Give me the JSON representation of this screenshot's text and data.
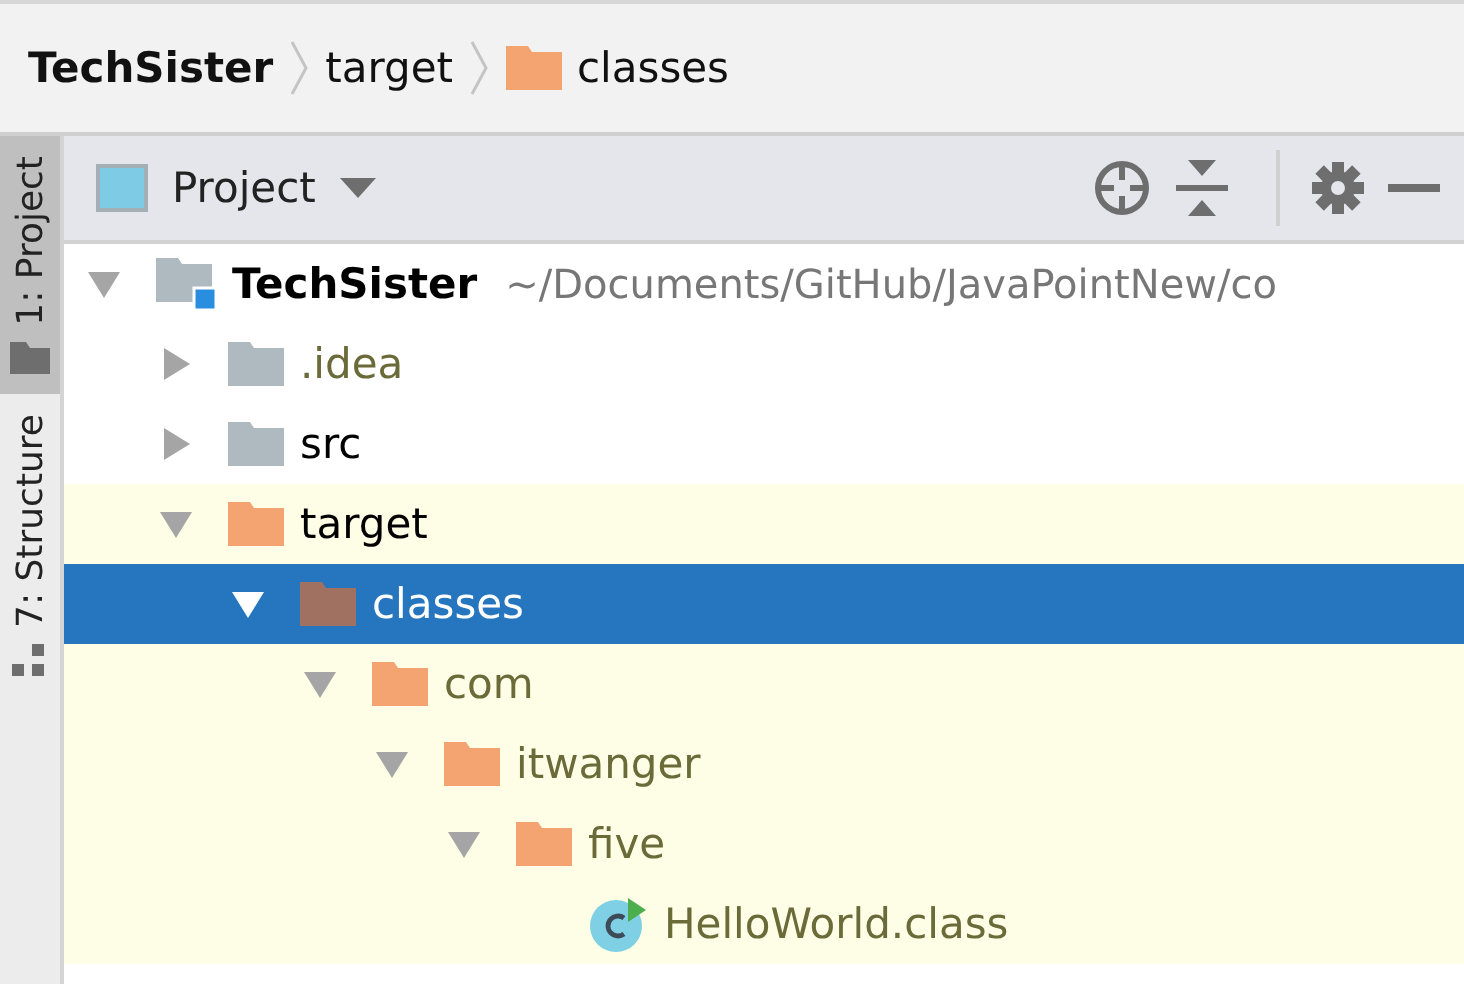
{
  "breadcrumbs": [
    {
      "label": "TechSister",
      "kind": "project"
    },
    {
      "label": "target",
      "kind": "plain"
    },
    {
      "label": "classes",
      "kind": "folder"
    }
  ],
  "side_tabs": [
    {
      "label": "1: Project",
      "selected": true
    },
    {
      "label": "7: Structure",
      "selected": false
    }
  ],
  "toolbar": {
    "title": "Project"
  },
  "tree": [
    {
      "label": "TechSister",
      "path": "~/Documents/GitHub/JavaPointNew/co",
      "kind": "module",
      "expanded": true,
      "selected": false,
      "highlighted": false,
      "color": "#000000",
      "children": [
        {
          "label": ".idea",
          "kind": "folder",
          "expanded": false,
          "selected": false,
          "highlighted": false,
          "color": "#6b6b3a"
        },
        {
          "label": "src",
          "kind": "folder",
          "expanded": false,
          "selected": false,
          "highlighted": false,
          "color": "#000000"
        },
        {
          "label": "target",
          "kind": "excluded",
          "expanded": true,
          "selected": false,
          "highlighted": true,
          "color": "#000000",
          "children": [
            {
              "label": "classes",
              "kind": "excluded",
              "expanded": true,
              "selected": true,
              "children": [
                {
                  "label": "com",
                  "kind": "excluded",
                  "expanded": true,
                  "selected": false,
                  "highlighted": true,
                  "color": "#6b6b3a",
                  "children": [
                    {
                      "label": "itwanger",
                      "kind": "excluded",
                      "expanded": true,
                      "selected": false,
                      "highlighted": true,
                      "color": "#6b6b3a",
                      "children": [
                        {
                          "label": "five",
                          "kind": "excluded",
                          "expanded": true,
                          "selected": false,
                          "highlighted": true,
                          "color": "#6b6b3a",
                          "children": [
                            {
                              "label": "HelloWorld.class",
                              "kind": "class",
                              "selected": false,
                              "highlighted": true,
                              "color": "#6b6b3a"
                            }
                          ]
                        }
                      ]
                    }
                  ]
                }
              ]
            }
          ]
        }
      ]
    }
  ]
}
